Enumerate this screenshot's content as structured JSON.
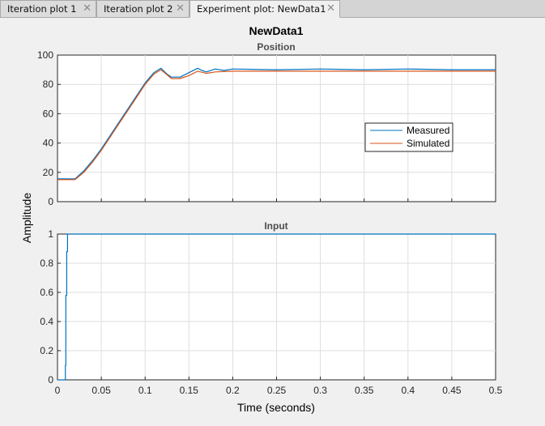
{
  "tabs": [
    {
      "label": "Iteration plot 1",
      "active": false
    },
    {
      "label": "Iteration plot 2",
      "active": false
    },
    {
      "label": "Experiment plot: NewData1",
      "active": true
    }
  ],
  "figure": {
    "title": "NewData1",
    "ylabel": "Amplitude",
    "xlabel": "Time (seconds)"
  },
  "chart_data": [
    {
      "type": "line",
      "title": "Position",
      "xlim": [
        0,
        0.5
      ],
      "ylim": [
        0,
        100
      ],
      "yticks": [
        "0",
        "20",
        "40",
        "60",
        "80",
        "100"
      ],
      "xticks": [],
      "grid": true,
      "legend": {
        "placement": "right",
        "entries": [
          "Measured",
          "Simulated"
        ]
      },
      "series": [
        {
          "name": "Measured",
          "color": "#0072bd",
          "x": [
            0,
            0.01,
            0.02,
            0.03,
            0.04,
            0.05,
            0.06,
            0.07,
            0.08,
            0.09,
            0.1,
            0.11,
            0.118,
            0.125,
            0.13,
            0.14,
            0.15,
            0.16,
            0.165,
            0.17,
            0.18,
            0.19,
            0.2,
            0.25,
            0.3,
            0.35,
            0.4,
            0.45,
            0.5
          ],
          "y": [
            15.5,
            15.5,
            15.5,
            21,
            28,
            36,
            45,
            54,
            63,
            72,
            81,
            88,
            91,
            87,
            85,
            85,
            88,
            91,
            89.5,
            88.5,
            90.5,
            89.5,
            90.5,
            90,
            90.5,
            90,
            90.5,
            90,
            90
          ]
        },
        {
          "name": "Simulated",
          "color": "#d95319",
          "x": [
            0,
            0.02,
            0.03,
            0.04,
            0.05,
            0.06,
            0.07,
            0.08,
            0.09,
            0.1,
            0.11,
            0.118,
            0.125,
            0.13,
            0.14,
            0.15,
            0.16,
            0.17,
            0.18,
            0.2,
            0.25,
            0.3,
            0.4,
            0.5
          ],
          "y": [
            15,
            15,
            20,
            27,
            35,
            44,
            53,
            62,
            71,
            80,
            87,
            90,
            86.5,
            84,
            84,
            86,
            89,
            87.5,
            88.5,
            89,
            89,
            89,
            89,
            89
          ]
        }
      ]
    },
    {
      "type": "line",
      "title": "Input",
      "xlim": [
        0,
        0.5
      ],
      "ylim": [
        0,
        1
      ],
      "yticks": [
        "0",
        "0.2",
        "0.4",
        "0.6",
        "0.8",
        "1"
      ],
      "xticks": [
        "0",
        "0.05",
        "0.1",
        "0.15",
        "0.2",
        "0.25",
        "0.3",
        "0.35",
        "0.4",
        "0.45",
        "0.5"
      ],
      "grid": true,
      "series": [
        {
          "color": "#0072bd",
          "x": [
            0,
            0.009,
            0.009,
            0.0095,
            0.0095,
            0.0105,
            0.0105,
            0.0115,
            0.0115,
            0.5
          ],
          "y": [
            0,
            0,
            0.1,
            0.1,
            0.58,
            0.58,
            0.88,
            0.88,
            1,
            1
          ]
        }
      ]
    }
  ]
}
